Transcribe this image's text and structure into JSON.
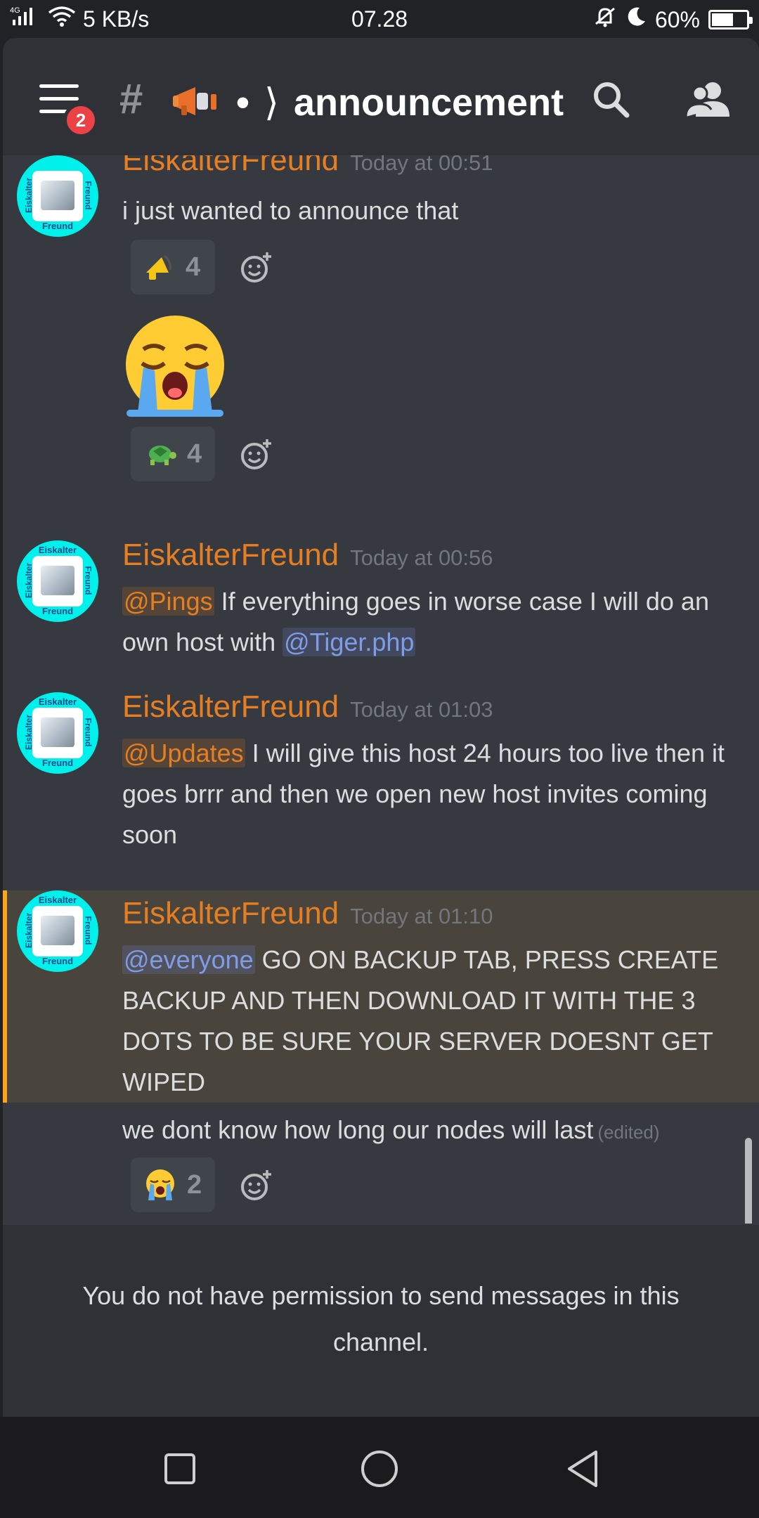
{
  "status_bar": {
    "network": "4G",
    "speed": "5 KB/s",
    "time": "07.28",
    "battery": "60%",
    "battery_level": 0.6
  },
  "header": {
    "menu_badge": "2",
    "channel_name": "announcement",
    "channel_separator": "•",
    "icons": [
      "menu-icon",
      "hash-icon",
      "megaphone-icon",
      "search-icon",
      "members-icon"
    ]
  },
  "messages": [
    {
      "author": "EiskalterFreund",
      "timestamp": "Today at 00:51",
      "text": "i just wanted to announce that",
      "reactions": [
        {
          "emoji": "megaphone",
          "count": "4"
        }
      ],
      "extra_emoji": "loudly-crying-face",
      "extra_reactions": [
        {
          "emoji": "turtle",
          "count": "4"
        }
      ]
    },
    {
      "author": "EiskalterFreund",
      "timestamp": "Today at 00:56",
      "mention": "@Pings",
      "text_a": " If everything goes in worse case I will do an own host with ",
      "mention_b": "@Tiger.php"
    },
    {
      "author": "EiskalterFreund",
      "timestamp": "Today at 01:03",
      "mention": "@Updates",
      "text": " I will give this host 24 hours too live then it goes brrr and then we open new host invites coming soon"
    },
    {
      "author": "EiskalterFreund",
      "timestamp": "Today at 01:10",
      "mention": "@everyone",
      "text": " GO ON BACKUP TAB, PRESS CREATE BACKUP AND THEN DOWNLOAD IT WITH THE 3 DOTS TO BE SURE YOUR SERVER DOESNT GET WIPED",
      "follow_up": "we dont know how long our nodes will last",
      "edited": "(edited)",
      "reactions": [
        {
          "emoji": "loudly-crying-face",
          "count": "2"
        }
      ]
    }
  ],
  "avatar": {
    "top": "Eiskalter",
    "bottom": "Freund",
    "left": "Eiskalter",
    "right": "Freund"
  },
  "no_permission": "You do not have permission to send messages in this channel.",
  "colors": {
    "author": "#e67e22",
    "background": "#36393f",
    "header": "#2f3136",
    "highlight": "#4a453c",
    "highlight_border": "#faa61a",
    "mention_blue": "#7f9ce6",
    "badge": "#ed4245"
  }
}
